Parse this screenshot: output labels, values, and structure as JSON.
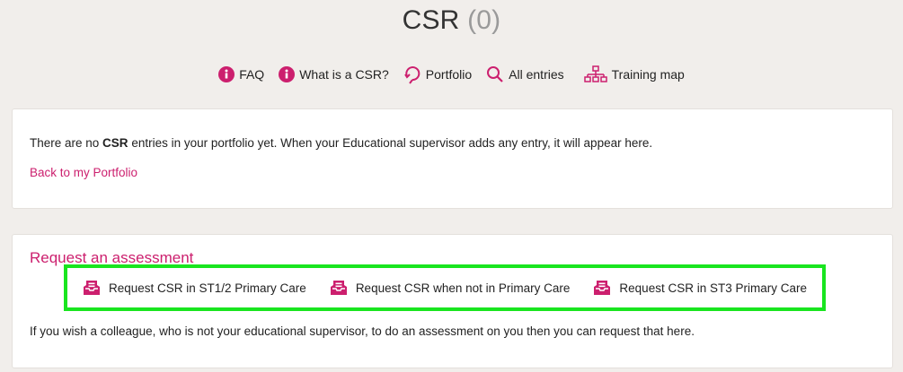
{
  "page": {
    "title": "CSR",
    "count": "(0)"
  },
  "nav": {
    "items": [
      {
        "label": "FAQ",
        "icon": "info-icon"
      },
      {
        "label": "What is a CSR?",
        "icon": "info-icon"
      },
      {
        "label": "Portfolio",
        "icon": "portfolio-icon"
      },
      {
        "label": "All entries",
        "icon": "search-icon"
      },
      {
        "label": "Training map",
        "icon": "sitemap-icon"
      }
    ]
  },
  "notice": {
    "prefix": "There are no ",
    "bold": "CSR",
    "suffix": " entries in your portfolio yet. When your Educational supervisor adds any entry, it will appear here.",
    "back_link": "Back to my Portfolio"
  },
  "request": {
    "title": "Request an assessment",
    "buttons": [
      {
        "label": "Request CSR in ST1/2 Primary Care",
        "icon": "inbox-icon"
      },
      {
        "label": "Request CSR when not in Primary Care",
        "icon": "inbox-icon"
      },
      {
        "label": "Request CSR in ST3 Primary Care",
        "icon": "inbox-icon"
      }
    ],
    "helper_text": "If you wish a colleague, who is not your educational supervisor, to do an assessment on you then you can request that here."
  },
  "colors": {
    "accent": "#cc1f6e",
    "highlight": "#19e51f",
    "background": "#f1eeeb"
  }
}
